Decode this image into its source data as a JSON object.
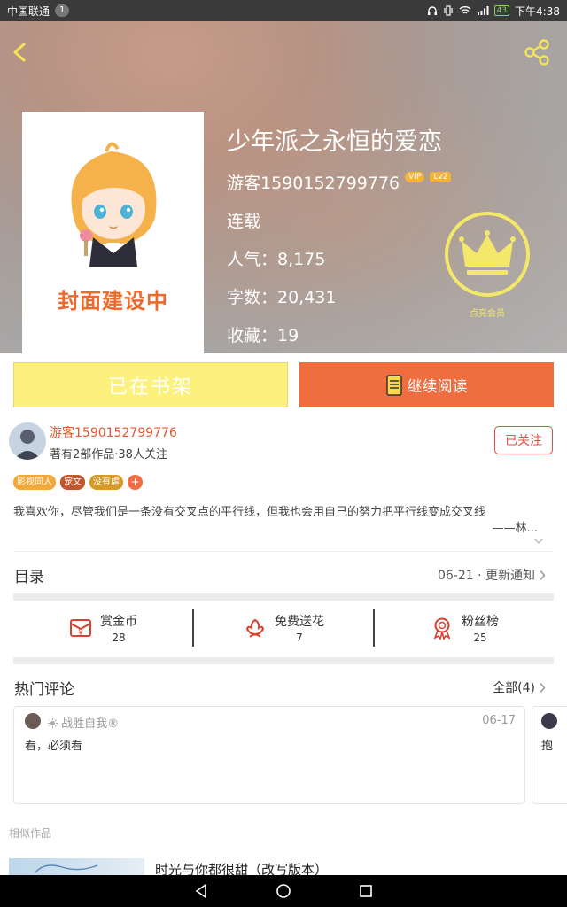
{
  "status_bar": {
    "carrier": "中国联通",
    "notification_count": "1",
    "battery": "43",
    "time": "下午4:38"
  },
  "book": {
    "title": "少年派之永恒的爱恋",
    "cover_caption": "封面建设中",
    "author": "游客1590152799776",
    "vip_badge": "VIP",
    "level_badge": "Lv2",
    "status": "连载",
    "popularity": "人气：8,175",
    "word_count": "字数：20,431",
    "favorites": "收藏：19"
  },
  "membership": {
    "caption": "点亮会员"
  },
  "actions": {
    "shelf_label": "已在书架",
    "read_label": "继续阅读"
  },
  "author_block": {
    "name": "游客1590152799776",
    "info": "著有2部作品·38人关注",
    "follow_label": "已关注"
  },
  "tags": [
    {
      "label": "影视同人",
      "color": "#f2a93b"
    },
    {
      "label": "宠文",
      "color": "#c0572e"
    },
    {
      "label": "没有虐",
      "color": "#d79a28"
    }
  ],
  "tag_add": "+",
  "intro": {
    "text": "我喜欢你，尽管我们是一条没有交叉点的平行线，但我也会用自己的努力把平行线变成交叉线",
    "signature": "——林..."
  },
  "toc": {
    "title": "目录",
    "update": "06-21 · 更新通知"
  },
  "stats": [
    {
      "label": "赏金币",
      "value": "28",
      "icon": "coin-envelope-icon"
    },
    {
      "label": "免费送花",
      "value": "7",
      "icon": "flower-icon"
    },
    {
      "label": "粉丝榜",
      "value": "25",
      "icon": "medal-icon"
    }
  ],
  "comments": {
    "title": "热门评论",
    "all_label": "全部(4)",
    "items": [
      {
        "user": "战胜自我®",
        "date": "06-17",
        "text": "看，必须看"
      },
      {
        "user": "",
        "date": "",
        "text": "抱"
      }
    ]
  },
  "similar": {
    "label": "相似作品",
    "items": [
      {
        "title": "时光与你都很甜（改写版本）"
      }
    ]
  },
  "colors": {
    "accent_orange": "#ef6d3e",
    "shelf_yellow": "#fbf17c",
    "crown_yellow": "#f3e86a",
    "author_red": "#e4572e"
  }
}
